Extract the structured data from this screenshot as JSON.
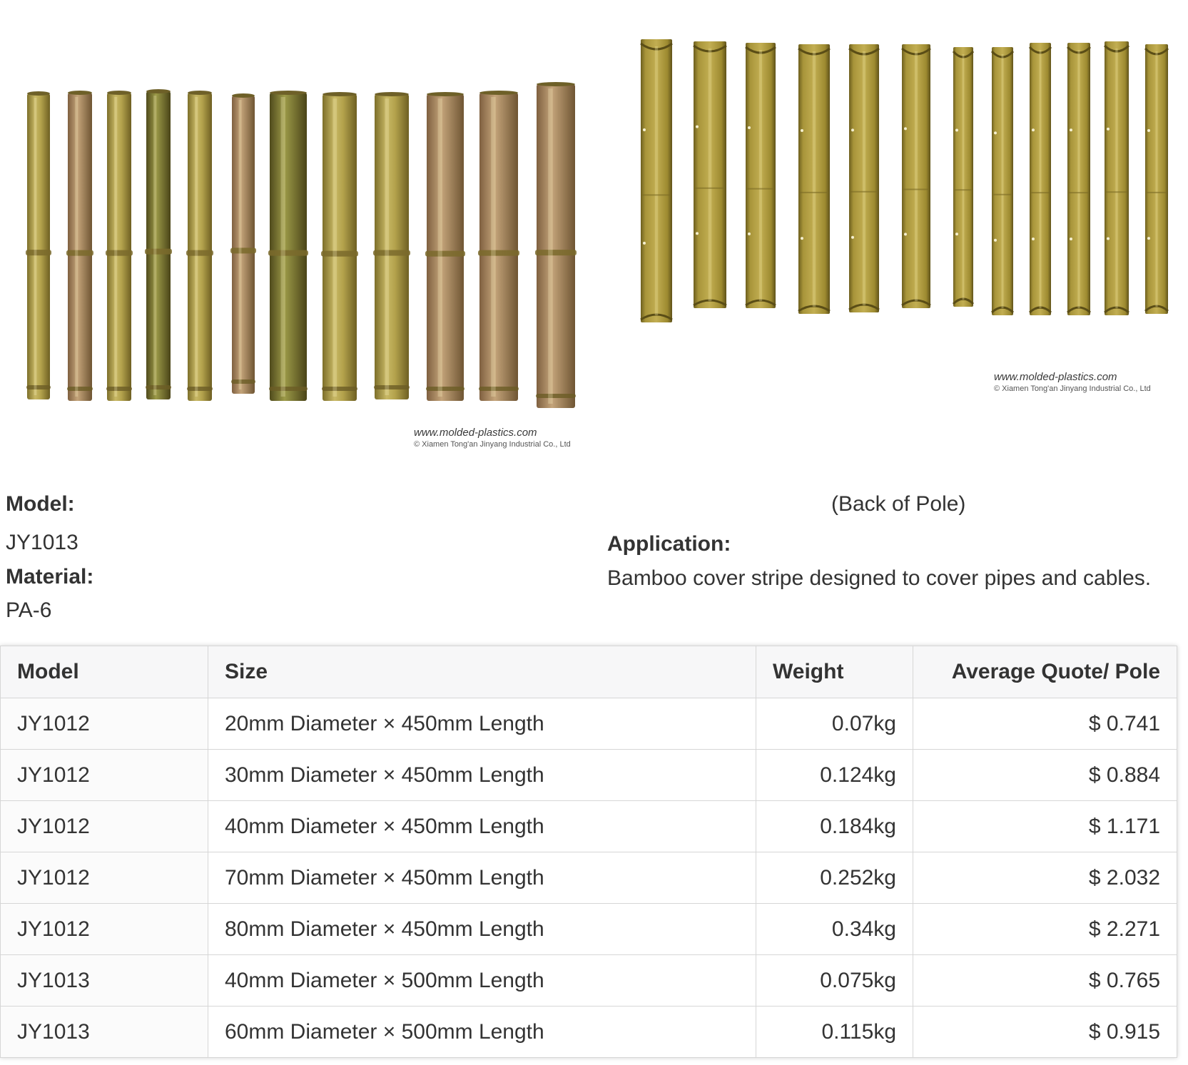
{
  "images": {
    "front": {
      "alt": "bamboo poles front",
      "watermark_url": "www.molded-plastics.com",
      "watermark_copyright": "© Xiamen Tong'an Jinyang Industrial Co., Ltd"
    },
    "back": {
      "alt": "bamboo poles back",
      "caption": "(Back of Pole)",
      "watermark_url": "www.molded-plastics.com",
      "watermark_copyright": "© Xiamen Tong'an Jinyang Industrial Co., Ltd"
    }
  },
  "details": {
    "model_label": "Model:",
    "model_value": "JY1013",
    "material_label": "Material:",
    "material_value": "PA-6",
    "application_label": "Application:",
    "application_value": "Bamboo cover stripe designed to cover pipes and cables."
  },
  "table": {
    "headers": [
      "Model",
      "Size",
      "Weight",
      "Average Quote/ Pole"
    ],
    "rows": [
      [
        "JY1012",
        "20mm Diameter × 450mm Length",
        "0.07kg",
        "$ 0.741"
      ],
      [
        "JY1012",
        "30mm Diameter × 450mm Length",
        "0.124kg",
        "$ 0.884"
      ],
      [
        "JY1012",
        "40mm Diameter × 450mm Length",
        "0.184kg",
        "$ 1.171"
      ],
      [
        "JY1012",
        "70mm Diameter × 450mm Length",
        "0.252kg",
        "$ 2.032"
      ],
      [
        "JY1012",
        "80mm Diameter × 450mm Length",
        "0.34kg",
        "$ 2.271"
      ],
      [
        "JY1013",
        "40mm Diameter × 500mm Length",
        "0.075kg",
        "$ 0.765"
      ],
      [
        "JY1013",
        "60mm Diameter × 500mm Length",
        "0.115kg",
        "$ 0.915"
      ]
    ]
  },
  "colors": {
    "bamboo_light": "#b8a84e",
    "bamboo_dark": "#8c7a2c",
    "bamboo_reddish": "#a88a5a",
    "channel_olive": "#9c8a30",
    "text": "#333333",
    "table_border": "#d6d6d6",
    "header_bg": "#f7f7f8"
  }
}
